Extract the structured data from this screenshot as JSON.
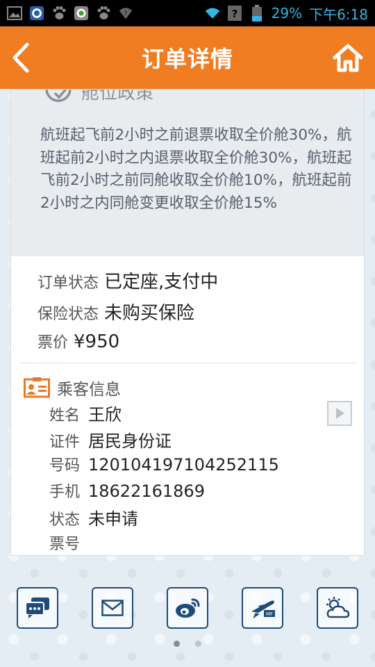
{
  "status_bar": {
    "battery": "29%",
    "time": "下午6:18"
  },
  "header": {
    "title": "订单详情"
  },
  "policy": {
    "heading": "舱位政策",
    "text": "航班起飞前2小时之前退票收取全价舱30%，航班起前2小时之内退票收取全价舱30%，航班起飞前2小时之前同舱收取全价舱10%，航班起前2小时之内同舱变更收取全价舱15%"
  },
  "order": {
    "status_label": "订单状态",
    "status_value": "已定座,支付中",
    "insurance_label": "保险状态",
    "insurance_value": "未购买保险",
    "price_label": "票价",
    "price_value": "¥950"
  },
  "passenger": {
    "title": "乘客信息",
    "name_label": "姓名",
    "name_value": "王欣",
    "id_type_label": "证件",
    "id_type_value": "居民身份证",
    "id_number_label": "号码",
    "id_number_value": "120104197104252115",
    "phone_label": "手机",
    "phone_value": "18622161869",
    "state_label": "状态",
    "state_value": "未申请",
    "ticket_label": "票号",
    "ticket_value": ""
  },
  "toolbar": {
    "icons": [
      "chat-icon",
      "mail-icon",
      "weibo-icon",
      "flight-icon",
      "weather-icon"
    ]
  },
  "pager": {
    "total": 2,
    "active": 0
  },
  "colors": {
    "header": "#f07d22",
    "accent_orange": "#e8792a",
    "toolbar_icon": "#1f4a7a",
    "status_bar_text": "#33b5e5"
  }
}
